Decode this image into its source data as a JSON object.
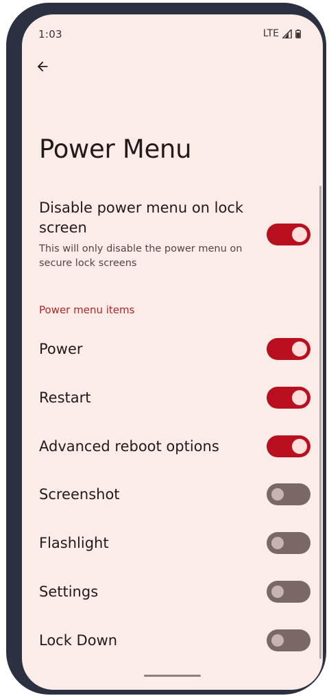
{
  "status_bar": {
    "time": "1:03",
    "network": "LTE",
    "signal_icon": "signal-icon",
    "battery_icon": "battery-icon"
  },
  "header": {
    "back_icon": "arrow-back-icon",
    "title": "Power Menu"
  },
  "lock_setting": {
    "title": "Disable power menu on lock screen",
    "summary": "This will only disable the power menu on secure lock screens",
    "enabled": true
  },
  "section": {
    "title": "Power menu items"
  },
  "items": [
    {
      "label": "Power",
      "enabled": true
    },
    {
      "label": "Restart",
      "enabled": true
    },
    {
      "label": "Advanced reboot options",
      "enabled": true
    },
    {
      "label": "Screenshot",
      "enabled": false
    },
    {
      "label": "Flashlight",
      "enabled": false
    },
    {
      "label": "Settings",
      "enabled": false
    },
    {
      "label": "Lock Down",
      "enabled": false
    }
  ],
  "colors": {
    "background": "#fcece8",
    "accent": "#b3232b",
    "toggle_on": "#b90f1f",
    "toggle_off": "#7a6866",
    "frame": "#2b3140"
  }
}
